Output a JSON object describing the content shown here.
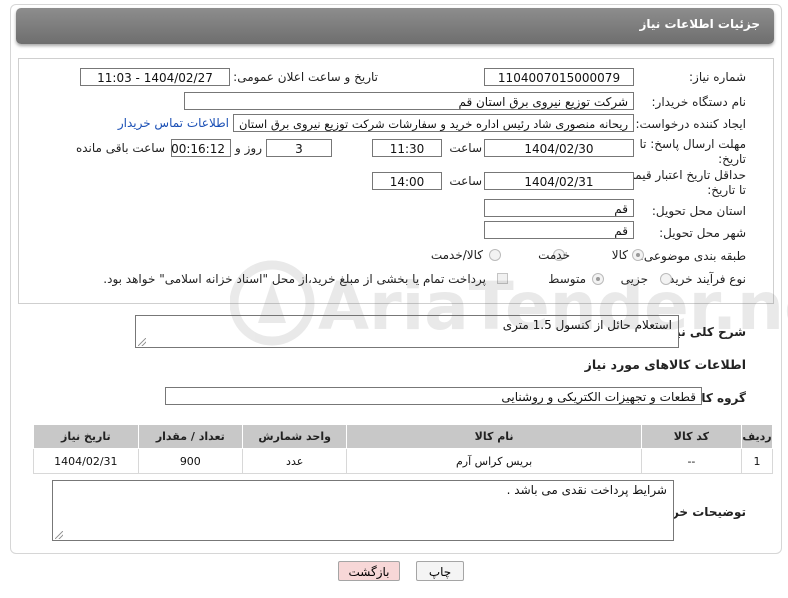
{
  "header": {
    "title": "جزئیات اطلاعات نیاز"
  },
  "form": {
    "need_number_label": "شماره نیاز:",
    "need_number": "1104007015000079",
    "announce_label": "تاریخ و ساعت اعلان عمومی:",
    "announce_value": "1404/02/27 - 11:03",
    "buyer_org_label": "نام دستگاه خریدار:",
    "buyer_org": "شرکت توزیع نیروی برق استان قم",
    "creator_label": "ایجاد کننده درخواست:",
    "creator": "ریحانه منصوری شاد رئیس اداره خرید و سفارشات شرکت توزیع نیروی برق استان",
    "contact_link": "اطلاعات تماس خریدار",
    "deadline_label_1": "مهلت ارسال پاسخ: تا",
    "deadline_label_2": "تاریخ:",
    "deadline_date": "1404/02/30",
    "time_label": "ساعت",
    "deadline_time": "11:30",
    "days_value": "3",
    "days_label": "روز و",
    "remaining_value": "00:16:12",
    "remaining_label": "ساعت باقی مانده",
    "validity_label_1": "حداقل تاریخ اعتبار قیمت:",
    "validity_label_2": "تا تاریخ:",
    "validity_date": "1404/02/31",
    "validity_time": "14:00",
    "province_label": "استان محل تحویل:",
    "province": "قم",
    "city_label": "شهر محل تحویل:",
    "city": "قم",
    "category_label": "طبقه بندی موضوعی:",
    "category_options": [
      "کالا",
      "خدمت",
      "کالا/خدمت"
    ],
    "category_selected": "کالا",
    "process_label": "نوع فرآیند خرید :",
    "process_options": [
      "جزیی",
      "متوسط"
    ],
    "process_selected": "متوسط",
    "payment_note": "پرداخت تمام یا بخشی از مبلغ خرید،از محل \"اسناد خزانه اسلامی\" خواهد بود."
  },
  "description": {
    "label": "شرح کلی نیاز:",
    "value": "استعلام حائل از کنسول 1.5 متری"
  },
  "goods": {
    "section_title": "اطلاعات کالاهای مورد نیاز",
    "group_label": "گروه کالا:",
    "group_value": "قطعات و تجهیزات الکتریکی و روشنایی",
    "columns": [
      "ردیف",
      "کد کالا",
      "نام کالا",
      "واحد شمارش",
      "تعداد / مقدار",
      "تاریخ نیاز"
    ],
    "rows": [
      [
        "1",
        "--",
        "بریس کراس آرم",
        "عدد",
        "900",
        "1404/02/31"
      ]
    ]
  },
  "buyer_notes": {
    "label": "توضیحات خریدار:",
    "value": "شرایط پرداخت نقدی می باشد ."
  },
  "buttons": {
    "print": "چاپ",
    "back": "بازگشت"
  },
  "watermark": {
    "text": "AriaTender.neT"
  }
}
